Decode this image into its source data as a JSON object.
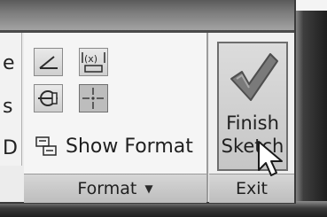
{
  "panel_format": {
    "show_format_label": "Show Format",
    "panel_label": "Format",
    "icons": [
      "dimension-angle-icon",
      "fit-dimension-icon",
      "constraint-circle-icon",
      "centerpoint-icon"
    ]
  },
  "panel_exit": {
    "finish_line1": "Finish",
    "finish_line2": "Sketch",
    "panel_label": "Exit"
  },
  "left_partial": {
    "chars": [
      "e",
      "s",
      "D"
    ]
  },
  "colors": {
    "check_green": "#6e6e6e",
    "panel_bg": "#ececec"
  }
}
